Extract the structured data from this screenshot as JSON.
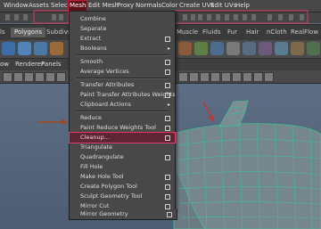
{
  "menubar": {
    "items": [
      "Window",
      "Assets",
      "Select",
      "Mesh",
      "Edit Mesh",
      "Proxy",
      "Normals",
      "Color",
      "Create UVs",
      "Edit UVs",
      "Help"
    ],
    "active_index": 3
  },
  "shelf": {
    "tabs": [
      "Polygons",
      "Subdivs",
      "Muscle",
      "Fluids",
      "Fur",
      "Hair",
      "nCloth",
      "RealFlow"
    ],
    "fragment": "ls"
  },
  "view_menu": {
    "items": [
      "ow",
      "Renderer",
      "Panels"
    ]
  },
  "mesh_menu": {
    "items": [
      {
        "label": "Combine",
        "option": false
      },
      {
        "label": "Separate",
        "option": false
      },
      {
        "label": "Extract",
        "option": true
      },
      {
        "label": "Booleans",
        "option": false,
        "submenu": true
      },
      {
        "label": "Smooth",
        "option": true
      },
      {
        "label": "Average Vertices",
        "option": true
      },
      {
        "label": "Transfer Attributes",
        "option": true
      },
      {
        "label": "Paint Transfer Attributes Weights Tool",
        "option": true
      },
      {
        "label": "Clipboard Actions",
        "option": false,
        "submenu": true
      },
      {
        "label": "Reduce",
        "option": true
      },
      {
        "label": "Paint Reduce Weights Tool",
        "option": true
      },
      {
        "label": "Cleanup...",
        "option": true,
        "highlight": true
      },
      {
        "label": "Triangulate",
        "option": false
      },
      {
        "label": "Quadrangulate",
        "option": true
      },
      {
        "label": "Fill Hole",
        "option": false
      },
      {
        "label": "Make Hole Tool",
        "option": true
      },
      {
        "label": "Create Polygon Tool",
        "option": true
      },
      {
        "label": "Sculpt Geometry Tool",
        "option": true
      },
      {
        "label": "Mirror Cut",
        "option": true
      },
      {
        "label": "Mirror Geometry",
        "option": true
      }
    ]
  },
  "colors": {
    "annotation_arrow": "#9a4a2c",
    "highlight_outline": "#e03a66",
    "mesh_surface": "#7a8a90",
    "wireframe": "#44c8a4",
    "viewport_bg": "#5a6b82"
  }
}
